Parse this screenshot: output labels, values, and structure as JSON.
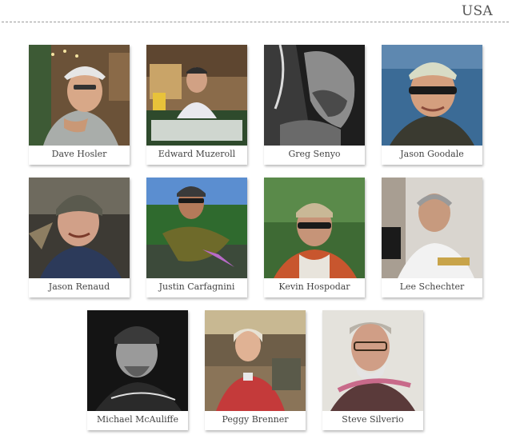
{
  "page": {
    "section_title": "USA"
  },
  "people": [
    {
      "name": "Dave Hosler",
      "photo": "dave-hosler-portrait"
    },
    {
      "name": "Edward Muzeroll",
      "photo": "edward-muzeroll-portrait"
    },
    {
      "name": "Greg Senyo",
      "photo": "greg-senyo-portrait"
    },
    {
      "name": "Jason Goodale",
      "photo": "jason-goodale-portrait"
    },
    {
      "name": "Jason Renaud",
      "photo": "jason-renaud-portrait"
    },
    {
      "name": "Justin Carfagnini",
      "photo": "justin-carfagnini-portrait"
    },
    {
      "name": "Kevin Hospodar",
      "photo": "kevin-hospodar-portrait"
    },
    {
      "name": "Lee Schechter",
      "photo": "lee-schechter-portrait"
    },
    {
      "name": "Michael McAuliffe",
      "photo": "michael-mcauliffe-portrait"
    },
    {
      "name": "Peggy Brenner",
      "photo": "peggy-brenner-portrait"
    },
    {
      "name": "Steve Silverio",
      "photo": "steve-silverio-portrait"
    }
  ]
}
